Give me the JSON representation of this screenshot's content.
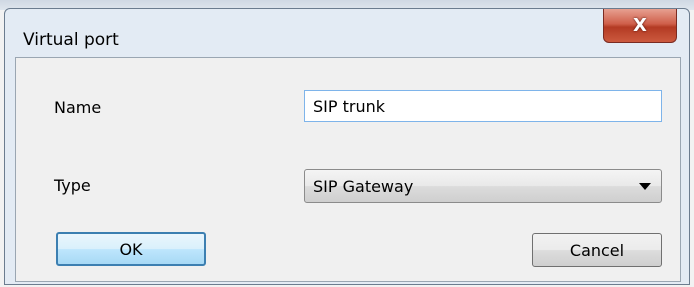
{
  "window": {
    "title": "Virtual port",
    "close_glyph": "X"
  },
  "form": {
    "name_label": "Name",
    "name_value": "SIP trunk",
    "type_label": "Type",
    "type_value": "SIP Gateway"
  },
  "buttons": {
    "ok_label": "OK",
    "cancel_label": "Cancel"
  },
  "icons": {
    "close": "close-icon",
    "dropdown": "chevron-down-icon"
  },
  "colors": {
    "close_button": "#c9553d",
    "input_focus_border": "#7eb4ea",
    "default_button_border": "#3c7fb1"
  }
}
